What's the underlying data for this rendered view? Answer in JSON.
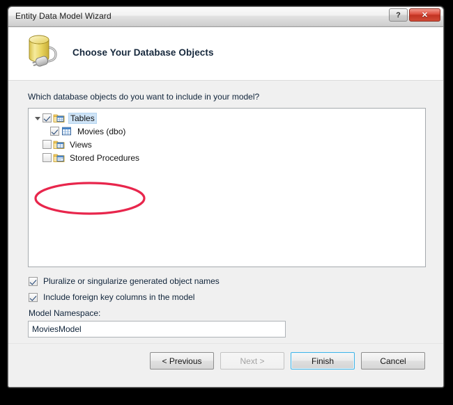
{
  "window": {
    "title": "Entity Data Model Wizard",
    "help_button": "?",
    "close_button": "✕"
  },
  "header": {
    "title": "Choose Your Database Objects",
    "icon": "database-plug-icon"
  },
  "main": {
    "prompt": "Which database objects do you want to include in your model?",
    "tree": [
      {
        "label": "Tables",
        "checked": true,
        "expanded": true,
        "selected": true,
        "icon": "tables-folder-icon",
        "children": [
          {
            "label": "Movies (dbo)",
            "checked": true,
            "icon": "table-grid-icon"
          }
        ]
      },
      {
        "label": "Views",
        "checked": false,
        "expanded": false,
        "selected": false,
        "icon": "views-folder-icon",
        "children": []
      },
      {
        "label": "Stored Procedures",
        "checked": false,
        "expanded": false,
        "selected": false,
        "icon": "stored-procedures-folder-icon",
        "children": []
      }
    ],
    "options": [
      {
        "label": "Pluralize or singularize generated object names",
        "checked": true
      },
      {
        "label": "Include foreign key columns in the model",
        "checked": true
      }
    ],
    "namespace": {
      "label": "Model Namespace:",
      "value": "MoviesModel",
      "placeholder": ""
    }
  },
  "footer": {
    "buttons": [
      {
        "label": "< Previous",
        "state": "enabled"
      },
      {
        "label": "Next >",
        "state": "disabled"
      },
      {
        "label": "Finish",
        "state": "default"
      },
      {
        "label": "Cancel",
        "state": "enabled"
      }
    ]
  },
  "annotation": {
    "shape": "red-ellipse",
    "color": "#e8264c",
    "encircles": "Tables and Movies (dbo) tree nodes"
  },
  "colors": {
    "accent_blue": "#3fb3e6",
    "selection_blue": "#cfe4f7",
    "annotation_red": "#e8264c",
    "close_red": "#c23322",
    "dialog_bg": "#f0f0f0"
  }
}
